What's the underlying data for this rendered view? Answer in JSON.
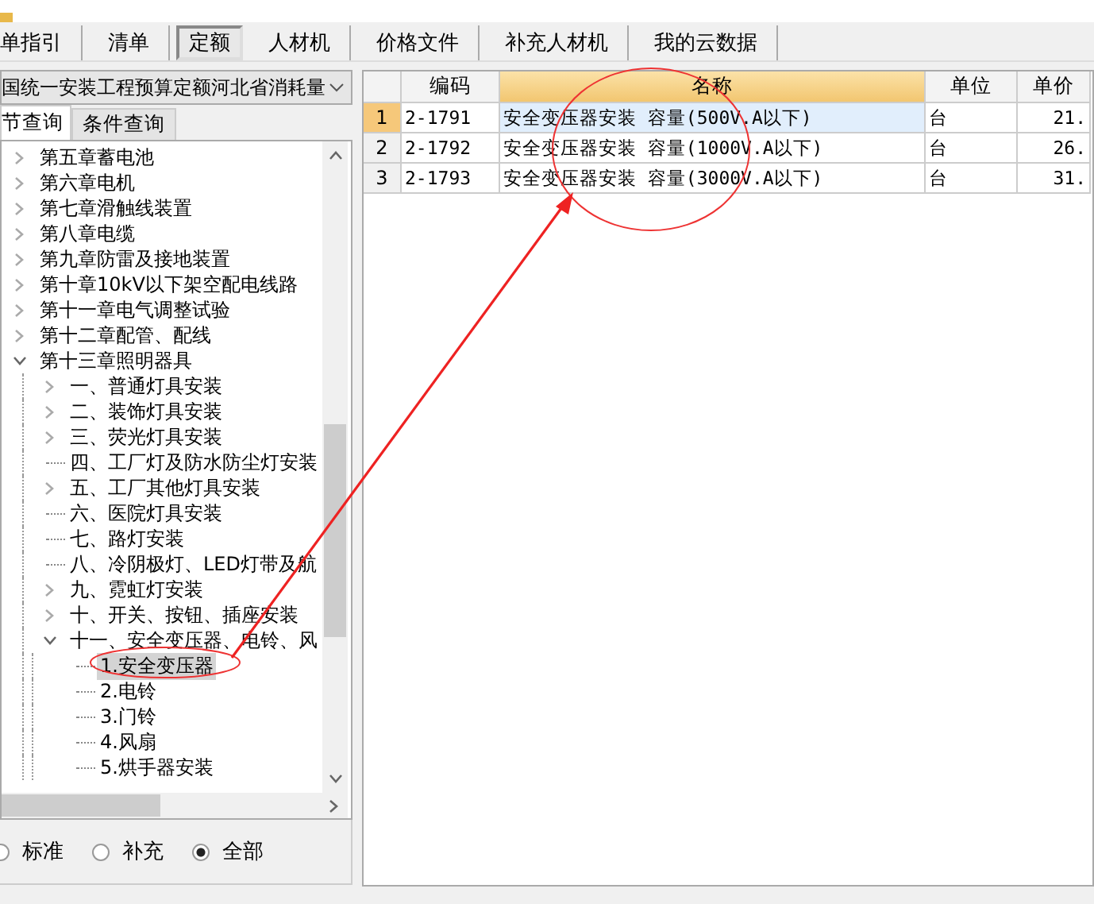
{
  "tabs": [
    {
      "label": "单指引",
      "selected": false
    },
    {
      "label": "清单",
      "selected": false
    },
    {
      "label": "定额",
      "selected": true
    },
    {
      "label": "人材机",
      "selected": false
    },
    {
      "label": "价格文件",
      "selected": false
    },
    {
      "label": "补充人材机",
      "selected": false
    },
    {
      "label": "我的云数据",
      "selected": false
    }
  ],
  "library_select": {
    "value": "国统一安装工程预算定额河北省消耗量"
  },
  "query_tabs": [
    {
      "label": "节查询",
      "selected": true
    },
    {
      "label": "条件查询",
      "selected": false
    }
  ],
  "tree": [
    {
      "label": "第五章蓄电池",
      "expanded": false,
      "selected": false
    },
    {
      "label": "第六章电机",
      "expanded": false,
      "selected": false
    },
    {
      "label": "第七章滑触线装置",
      "expanded": false,
      "selected": false
    },
    {
      "label": "第八章电缆",
      "expanded": false,
      "selected": false
    },
    {
      "label": "第九章防雷及接地装置",
      "expanded": false,
      "selected": false
    },
    {
      "label": "第十章10kV以下架空配电线路",
      "expanded": false,
      "selected": false
    },
    {
      "label": "第十一章电气调整试验",
      "expanded": false,
      "selected": false
    },
    {
      "label": "第十二章配管、配线",
      "expanded": false,
      "selected": false
    },
    {
      "label": "第十三章照明器具",
      "expanded": true,
      "selected": false,
      "children": [
        {
          "label": "一、普通灯具安装",
          "expanded": false,
          "selected": false
        },
        {
          "label": "二、装饰灯具安装",
          "expanded": false,
          "selected": false
        },
        {
          "label": "三、荧光灯具安装",
          "expanded": false,
          "selected": false
        },
        {
          "label": "四、工厂灯及防水防尘灯安装",
          "selected": false
        },
        {
          "label": "五、工厂其他灯具安装",
          "expanded": false,
          "selected": false
        },
        {
          "label": "六、医院灯具安装",
          "selected": false
        },
        {
          "label": "七、路灯安装",
          "selected": false
        },
        {
          "label": "八、冷阴极灯、LED灯带及航",
          "selected": false
        },
        {
          "label": "九、霓虹灯安装",
          "expanded": false,
          "selected": false
        },
        {
          "label": "十、开关、按钮、插座安装",
          "expanded": false,
          "selected": false
        },
        {
          "label": "十一、安全变压器、电铃、风",
          "expanded": true,
          "selected": false,
          "children": [
            {
              "label": "1.安全变压器",
              "selected": true
            },
            {
              "label": "2.电铃",
              "selected": false
            },
            {
              "label": "3.门铃",
              "selected": false
            },
            {
              "label": "4.风扇",
              "selected": false
            },
            {
              "label": "5.烘手器安装",
              "selected": false
            }
          ]
        }
      ]
    }
  ],
  "filters": [
    {
      "label": "标准",
      "selected": false
    },
    {
      "label": "补充",
      "selected": false
    },
    {
      "label": "全部",
      "selected": true
    }
  ],
  "table": {
    "columns": [
      {
        "label": "编码",
        "selected": false
      },
      {
        "label": "名称",
        "selected": true
      },
      {
        "label": "单位",
        "selected": false
      },
      {
        "label": "单价",
        "selected": false
      }
    ],
    "rows": [
      {
        "index": "1",
        "cells": [
          "2-1791",
          "安全变压器安装 容量(500V.A以下)",
          "台",
          "21."
        ],
        "selected": true
      },
      {
        "index": "2",
        "cells": [
          "2-1792",
          "安全变压器安装 容量(1000V.A以下)",
          "台",
          "26."
        ],
        "selected": false
      },
      {
        "index": "3",
        "cells": [
          "2-1793",
          "安全变压器安装 容量(3000V.A以下)",
          "台",
          "31."
        ],
        "selected": false
      }
    ]
  }
}
